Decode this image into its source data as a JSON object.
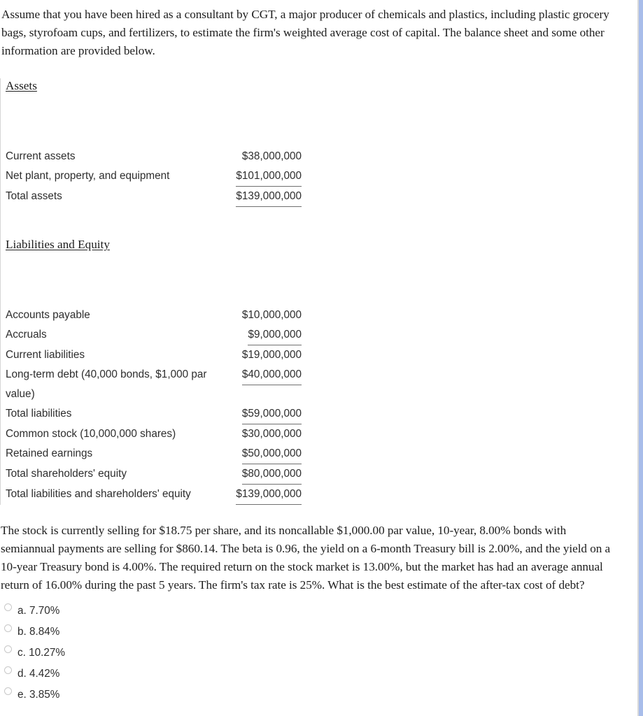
{
  "intro": {
    "paragraph": "Assume that you have been hired as a consultant by CGT, a major producer of chemicals and plastics, including plastic grocery bags, styrofoam cups, and fertilizers, to estimate the firm's weighted average cost of capital. The balance sheet and some other information are provided below."
  },
  "balance_sheet": {
    "assets_heading": "Assets",
    "assets_rows": [
      {
        "label": "Current assets",
        "value": "$38,000,000",
        "underlined": false
      },
      {
        "label": "Net plant, property, and equipment",
        "value": "$101,000,000",
        "underlined": true
      },
      {
        "label": "Total assets",
        "value": "$139,000,000",
        "underlined": true
      }
    ],
    "liabilities_heading": "Liabilities and Equity",
    "liabilities_rows": [
      {
        "label": "Accounts payable",
        "value": "$10,000,000",
        "underlined": false
      },
      {
        "label": "Accruals",
        "value": "$9,000,000",
        "underlined": true
      },
      {
        "label": "Current liabilities",
        "value": "$19,000,000",
        "underlined": false
      },
      {
        "label": "Long-term debt (40,000 bonds, $1,000 par value)",
        "value": "$40,000,000",
        "underlined": true
      },
      {
        "label": "Total liabilities",
        "value": "$59,000,000",
        "underlined": true
      },
      {
        "label": "Common stock (10,000,000 shares)",
        "value": "$30,000,000",
        "underlined": false
      },
      {
        "label": "Retained earnings",
        "value": "$50,000,000",
        "underlined": true
      },
      {
        "label": "Total shareholders' equity",
        "value": "$80,000,000",
        "underlined": true
      },
      {
        "label": "Total liabilities and shareholders' equity",
        "value": "$139,000,000",
        "underlined": true
      }
    ]
  },
  "question": {
    "paragraph": "The stock is currently selling for $18.75 per share, and its noncallable $1,000.00 par value, 10-year, 8.00% bonds with semiannual payments are selling for $860.14. The beta is 0.96, the yield on a 6-month Treasury bill is 2.00%, and the yield on a 10-year Treasury bond is 4.00%. The required return on the stock market is 13.00%, but the market has had an average annual return of 16.00% during the past 5 years. The firm's tax rate is 25%. What is the best estimate of the after-tax cost of debt?"
  },
  "choices": [
    {
      "label": "a. 7.70%"
    },
    {
      "label": "b. 8.84%"
    },
    {
      "label": "c. 10.27%"
    },
    {
      "label": "d. 4.42%"
    },
    {
      "label": "e. 3.85%"
    }
  ],
  "colors": {
    "text": "#2d2d2d",
    "prose_text": "#1d1d1d",
    "rule": "#707070",
    "edge_blue": "#a8bdea",
    "edge_gray": "#d9d9d9"
  }
}
